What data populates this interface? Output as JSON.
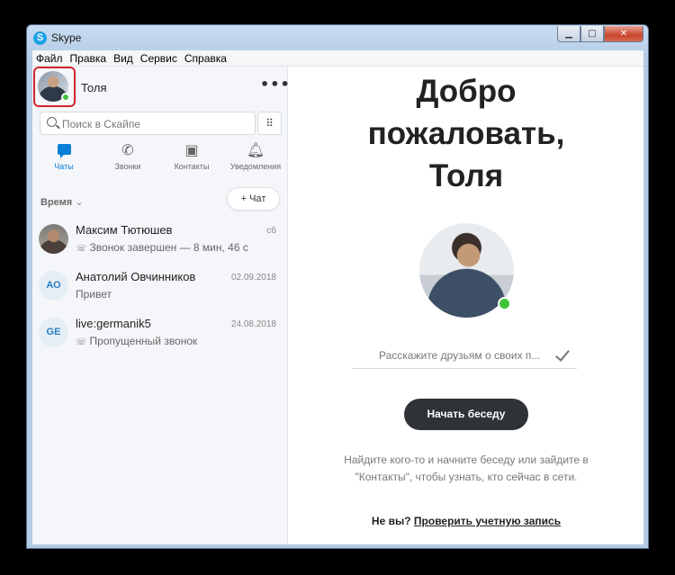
{
  "window": {
    "title": "Skype"
  },
  "menu": [
    "Файл",
    "Правка",
    "Вид",
    "Сервис",
    "Справка"
  ],
  "profile": {
    "name": "Толя",
    "status_color": "#3fc43a"
  },
  "search": {
    "placeholder": "Поиск в Скайпе"
  },
  "tabs": [
    {
      "label": "Чаты",
      "icon": "chat-icon",
      "active": true
    },
    {
      "label": "Звонки",
      "icon": "phone-icon"
    },
    {
      "label": "Контакты",
      "icon": "contacts-icon"
    },
    {
      "label": "Уведомления",
      "icon": "bell-icon"
    }
  ],
  "list_header": {
    "sort_label": "Время",
    "new_chat_label": "+ Чат"
  },
  "chats": [
    {
      "name": "Максим Тютюшев",
      "date": "сб",
      "preview": "Звонок завершен — 8 мин, 46 с",
      "avatar": "photo",
      "preview_icon": "call-ended-icon"
    },
    {
      "name": "Анатолий Овчинников",
      "date": "02.09.2018",
      "preview": "Привет",
      "initials": "АО"
    },
    {
      "name": "live:germanik5",
      "date": "24.08.2018",
      "preview": "Пропущенный звонок",
      "initials": "GE",
      "preview_icon": "missed-call-icon"
    }
  ],
  "welcome": {
    "line1": "Добро",
    "line2": "пожаловать,",
    "line3": "Толя",
    "mood_placeholder": "Расскажите друзьям о своих п...",
    "start_button": "Начать беседу",
    "hint": "Найдите кого-то и начните беседу или зайдите в \"Контакты\", чтобы узнать, кто сейчас в сети.",
    "not_you": "Не вы?",
    "check_account": "Проверить учетную запись"
  },
  "colors": {
    "accent": "#0b7fd8",
    "highlight_border": "#d1262f",
    "button_dark": "#2f3236"
  }
}
